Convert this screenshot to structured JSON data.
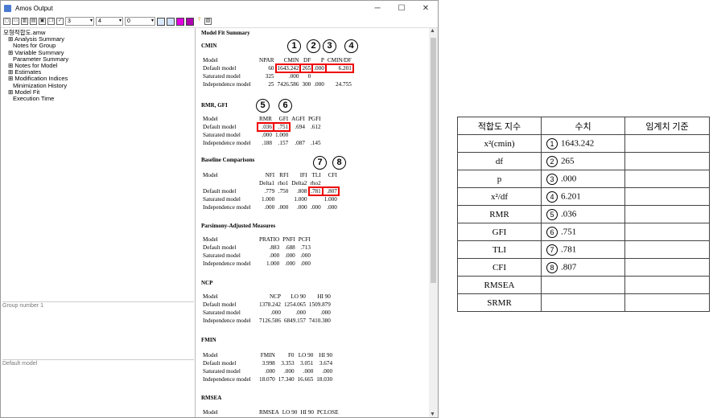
{
  "window": {
    "title": "Amos Output",
    "min": "─",
    "max": "☐",
    "close": "✕"
  },
  "toolbar": {
    "sel1": "3",
    "sel2": "4",
    "sel3": "0"
  },
  "tree": [
    "모형적합도.amw",
    "⊞ Analysis Summary",
    "Notes for Group",
    "⊞ Variable Summary",
    "Parameter Summary",
    "⊞ Notes for Model",
    "⊞ Estimates",
    "⊞ Modification Indices",
    "Minimization History",
    "⊞ Model Fit",
    "Execution Time"
  ],
  "panes": {
    "group": "Group number 1",
    "model": "Default model"
  },
  "output": {
    "title": "Model Fit Summary",
    "cmin": {
      "heading": "CMIN",
      "header": [
        "Model",
        "NPAR",
        "CMIN",
        "DF",
        "P",
        "CMIN/DF"
      ],
      "rows": [
        [
          "Default model",
          "60",
          "1643.242",
          "265",
          ".000",
          "6.201"
        ],
        [
          "Saturated model",
          "325",
          ".000",
          "0",
          "",
          ""
        ],
        [
          "Independence model",
          "25",
          "7426.586",
          "300",
          ".000",
          "24.755"
        ]
      ]
    },
    "rmr": {
      "heading": "RMR, GFI",
      "header": [
        "Model",
        "RMR",
        "GFI",
        "AGFI",
        "PGFI"
      ],
      "rows": [
        [
          "Default model",
          ".036",
          ".751",
          ".694",
          ".612"
        ],
        [
          "Saturated model",
          ".000",
          "1.000",
          "",
          ""
        ],
        [
          "Independence model",
          ".188",
          ".157",
          ".087",
          ".145"
        ]
      ]
    },
    "baseline": {
      "heading": "Baseline Comparisons",
      "header": [
        "Model",
        "NFI",
        "RFI",
        "IFI",
        "TLI",
        "CFI"
      ],
      "header2": [
        "",
        "Delta1",
        "rho1",
        "Delta2",
        "rho2",
        ""
      ],
      "rows": [
        [
          "Default model",
          ".779",
          ".750",
          ".808",
          ".781",
          ".807"
        ],
        [
          "Saturated model",
          "1.000",
          "",
          "1.000",
          "",
          "1.000"
        ],
        [
          "Independence model",
          ".000",
          ".000",
          ".000",
          ".000",
          ".000"
        ]
      ]
    },
    "parsimony": {
      "heading": "Parsimony-Adjusted Measures",
      "header": [
        "Model",
        "PRATIO",
        "PNFI",
        "PCFI"
      ],
      "rows": [
        [
          "Default model",
          ".883",
          ".688",
          ".713"
        ],
        [
          "Saturated model",
          ".000",
          ".000",
          ".000"
        ],
        [
          "Independence model",
          "1.000",
          ".000",
          ".000"
        ]
      ]
    },
    "ncp": {
      "heading": "NCP",
      "header": [
        "Model",
        "NCP",
        "LO 90",
        "HI 90"
      ],
      "rows": [
        [
          "Default model",
          "1378.242",
          "1254.065",
          "1509.879"
        ],
        [
          "Saturated model",
          ".000",
          ".000",
          ".000"
        ],
        [
          "Independence model",
          "7126.586",
          "6849.157",
          "7410.380"
        ]
      ]
    },
    "fmin": {
      "heading": "FMIN",
      "header": [
        "Model",
        "FMIN",
        "F0",
        "LO 90",
        "HI 90"
      ],
      "rows": [
        [
          "Default model",
          "3.998",
          "3.353",
          "3.051",
          "3.674"
        ],
        [
          "Saturated model",
          ".000",
          ".000",
          ".000",
          ".000"
        ],
        [
          "Independence model",
          "18.070",
          "17.340",
          "16.665",
          "18.030"
        ]
      ]
    },
    "rmsea": {
      "heading": "RMSEA",
      "header": [
        "Model",
        "RMSEA",
        "LO 90",
        "HI 90",
        "PCLOSE"
      ]
    }
  },
  "summary": {
    "header": [
      "적합도 지수",
      "수치",
      "임계치 기준"
    ],
    "rows": [
      [
        "x²(cmin)",
        "1",
        "1643.242"
      ],
      [
        "df",
        "2",
        "265"
      ],
      [
        "p",
        "3",
        ".000"
      ],
      [
        "x²/df",
        "4",
        "6.201"
      ],
      [
        "RMR",
        "5",
        ".036"
      ],
      [
        "GFI",
        "6",
        ".751"
      ],
      [
        "TLI",
        "7",
        ".781"
      ],
      [
        "CFI",
        "8",
        ".807"
      ],
      [
        "RMSEA",
        "",
        ""
      ],
      [
        "SRMR",
        "",
        ""
      ]
    ]
  }
}
